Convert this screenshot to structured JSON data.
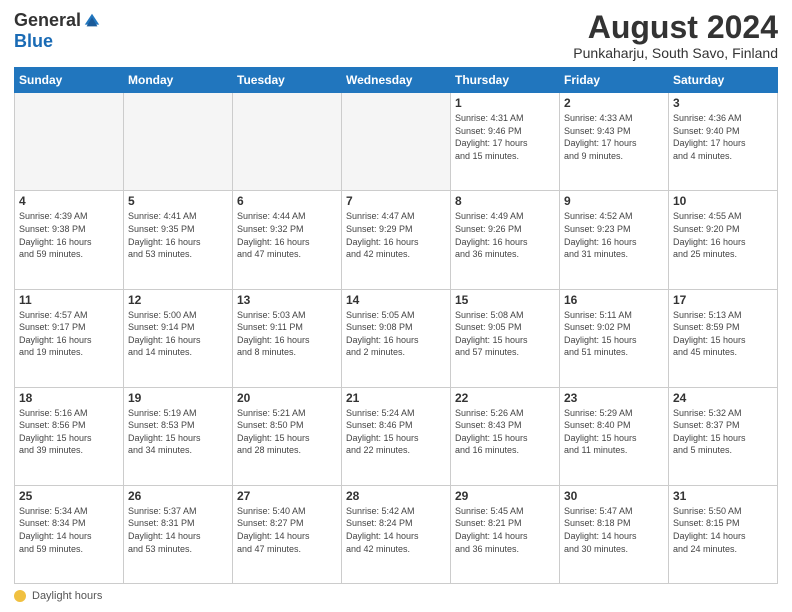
{
  "header": {
    "logo_general": "General",
    "logo_blue": "Blue",
    "main_title": "August 2024",
    "subtitle": "Punkaharju, South Savo, Finland"
  },
  "footer": {
    "label": "Daylight hours"
  },
  "days_of_week": [
    "Sunday",
    "Monday",
    "Tuesday",
    "Wednesday",
    "Thursday",
    "Friday",
    "Saturday"
  ],
  "weeks": [
    [
      {
        "day": "",
        "info": ""
      },
      {
        "day": "",
        "info": ""
      },
      {
        "day": "",
        "info": ""
      },
      {
        "day": "",
        "info": ""
      },
      {
        "day": "1",
        "info": "Sunrise: 4:31 AM\nSunset: 9:46 PM\nDaylight: 17 hours\nand 15 minutes."
      },
      {
        "day": "2",
        "info": "Sunrise: 4:33 AM\nSunset: 9:43 PM\nDaylight: 17 hours\nand 9 minutes."
      },
      {
        "day": "3",
        "info": "Sunrise: 4:36 AM\nSunset: 9:40 PM\nDaylight: 17 hours\nand 4 minutes."
      }
    ],
    [
      {
        "day": "4",
        "info": "Sunrise: 4:39 AM\nSunset: 9:38 PM\nDaylight: 16 hours\nand 59 minutes."
      },
      {
        "day": "5",
        "info": "Sunrise: 4:41 AM\nSunset: 9:35 PM\nDaylight: 16 hours\nand 53 minutes."
      },
      {
        "day": "6",
        "info": "Sunrise: 4:44 AM\nSunset: 9:32 PM\nDaylight: 16 hours\nand 47 minutes."
      },
      {
        "day": "7",
        "info": "Sunrise: 4:47 AM\nSunset: 9:29 PM\nDaylight: 16 hours\nand 42 minutes."
      },
      {
        "day": "8",
        "info": "Sunrise: 4:49 AM\nSunset: 9:26 PM\nDaylight: 16 hours\nand 36 minutes."
      },
      {
        "day": "9",
        "info": "Sunrise: 4:52 AM\nSunset: 9:23 PM\nDaylight: 16 hours\nand 31 minutes."
      },
      {
        "day": "10",
        "info": "Sunrise: 4:55 AM\nSunset: 9:20 PM\nDaylight: 16 hours\nand 25 minutes."
      }
    ],
    [
      {
        "day": "11",
        "info": "Sunrise: 4:57 AM\nSunset: 9:17 PM\nDaylight: 16 hours\nand 19 minutes."
      },
      {
        "day": "12",
        "info": "Sunrise: 5:00 AM\nSunset: 9:14 PM\nDaylight: 16 hours\nand 14 minutes."
      },
      {
        "day": "13",
        "info": "Sunrise: 5:03 AM\nSunset: 9:11 PM\nDaylight: 16 hours\nand 8 minutes."
      },
      {
        "day": "14",
        "info": "Sunrise: 5:05 AM\nSunset: 9:08 PM\nDaylight: 16 hours\nand 2 minutes."
      },
      {
        "day": "15",
        "info": "Sunrise: 5:08 AM\nSunset: 9:05 PM\nDaylight: 15 hours\nand 57 minutes."
      },
      {
        "day": "16",
        "info": "Sunrise: 5:11 AM\nSunset: 9:02 PM\nDaylight: 15 hours\nand 51 minutes."
      },
      {
        "day": "17",
        "info": "Sunrise: 5:13 AM\nSunset: 8:59 PM\nDaylight: 15 hours\nand 45 minutes."
      }
    ],
    [
      {
        "day": "18",
        "info": "Sunrise: 5:16 AM\nSunset: 8:56 PM\nDaylight: 15 hours\nand 39 minutes."
      },
      {
        "day": "19",
        "info": "Sunrise: 5:19 AM\nSunset: 8:53 PM\nDaylight: 15 hours\nand 34 minutes."
      },
      {
        "day": "20",
        "info": "Sunrise: 5:21 AM\nSunset: 8:50 PM\nDaylight: 15 hours\nand 28 minutes."
      },
      {
        "day": "21",
        "info": "Sunrise: 5:24 AM\nSunset: 8:46 PM\nDaylight: 15 hours\nand 22 minutes."
      },
      {
        "day": "22",
        "info": "Sunrise: 5:26 AM\nSunset: 8:43 PM\nDaylight: 15 hours\nand 16 minutes."
      },
      {
        "day": "23",
        "info": "Sunrise: 5:29 AM\nSunset: 8:40 PM\nDaylight: 15 hours\nand 11 minutes."
      },
      {
        "day": "24",
        "info": "Sunrise: 5:32 AM\nSunset: 8:37 PM\nDaylight: 15 hours\nand 5 minutes."
      }
    ],
    [
      {
        "day": "25",
        "info": "Sunrise: 5:34 AM\nSunset: 8:34 PM\nDaylight: 14 hours\nand 59 minutes."
      },
      {
        "day": "26",
        "info": "Sunrise: 5:37 AM\nSunset: 8:31 PM\nDaylight: 14 hours\nand 53 minutes."
      },
      {
        "day": "27",
        "info": "Sunrise: 5:40 AM\nSunset: 8:27 PM\nDaylight: 14 hours\nand 47 minutes."
      },
      {
        "day": "28",
        "info": "Sunrise: 5:42 AM\nSunset: 8:24 PM\nDaylight: 14 hours\nand 42 minutes."
      },
      {
        "day": "29",
        "info": "Sunrise: 5:45 AM\nSunset: 8:21 PM\nDaylight: 14 hours\nand 36 minutes."
      },
      {
        "day": "30",
        "info": "Sunrise: 5:47 AM\nSunset: 8:18 PM\nDaylight: 14 hours\nand 30 minutes."
      },
      {
        "day": "31",
        "info": "Sunrise: 5:50 AM\nSunset: 8:15 PM\nDaylight: 14 hours\nand 24 minutes."
      }
    ]
  ]
}
